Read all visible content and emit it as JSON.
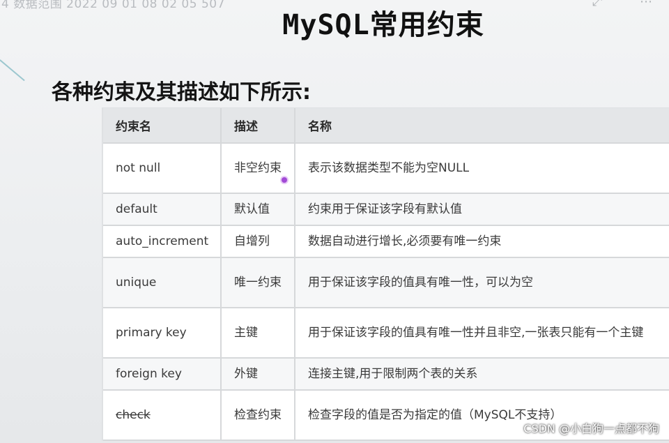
{
  "top_bar": {
    "video_title": "4 数据范围 2022 09 01 08 02 05 507"
  },
  "slide": {
    "title": "MySQL常用约束",
    "intro": "各种约束及其描述如下所示:"
  },
  "table": {
    "headers": [
      "约束名",
      "描述",
      "名称"
    ],
    "rows": [
      {
        "name": "not null",
        "desc": "非空约束",
        "detail": "表示该数据类型不能为空NULL",
        "strike": false
      },
      {
        "name": "default",
        "desc": "默认值",
        "detail": "约束用于保证该字段有默认值",
        "strike": false
      },
      {
        "name": "auto_increment",
        "desc": "自增列",
        "detail": "数据自动进行增长,必须要有唯一约束",
        "strike": false
      },
      {
        "name": "unique",
        "desc": "唯一约束",
        "detail": "用于保证该字段的值具有唯一性，可以为空",
        "strike": false
      },
      {
        "name": "primary key",
        "desc": "主键",
        "detail": "用于保证该字段的值具有唯一性并且非空,一张表只能有一个主键",
        "strike": false
      },
      {
        "name": "foreign key",
        "desc": "外键",
        "detail": "连接主键,用于限制两个表的关系",
        "strike": false
      },
      {
        "name": "check",
        "desc": "检查约束",
        "detail": "检查字段的值是否为指定的值（MySQL不支持）",
        "strike": true
      }
    ]
  },
  "watermark": "CSDN @小白狗一点都不狗",
  "icons": {
    "expand": "expand-icon",
    "more": "more-icon"
  },
  "colors": {
    "header_bg": "#e4e6e8",
    "cursor": "#a24bd6"
  }
}
